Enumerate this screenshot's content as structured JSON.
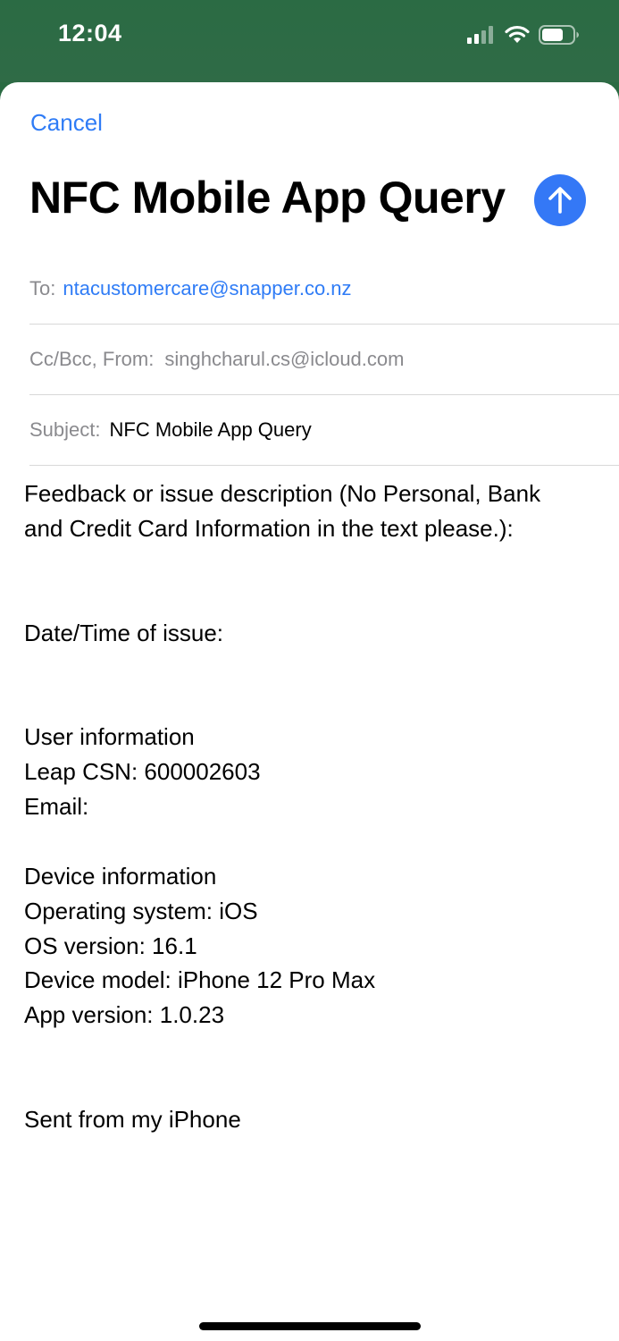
{
  "status_bar": {
    "time": "12:04"
  },
  "compose": {
    "cancel_label": "Cancel",
    "title": "NFC Mobile App Query",
    "to_label": "To:",
    "to_value": "ntacustomercare@snapper.co.nz",
    "cc_label": "Cc/Bcc, From:",
    "cc_value": "singhcharul.cs@icloud.com",
    "subject_label": "Subject:",
    "subject_value": "NFC Mobile App Query"
  },
  "body": {
    "feedback_line1": "Feedback or issue description (No Personal, Bank",
    "feedback_line2": "and Credit Card Information in the text please.):",
    "date_time": "Date/Time of issue:",
    "user_info": "User information",
    "leap_csn": "Leap CSN: 600002603",
    "email": "Email:",
    "device_info": "Device information",
    "os": "Operating system: iOS",
    "os_version": "OS version: 16.1",
    "device_model": "Device model: iPhone 12 Pro Max",
    "app_version": "App version: 1.0.23",
    "signature": "Sent from my iPhone"
  },
  "colors": {
    "accent": "#3478f6",
    "link": "#2f7cf6",
    "header_green": "#2b6b44"
  }
}
